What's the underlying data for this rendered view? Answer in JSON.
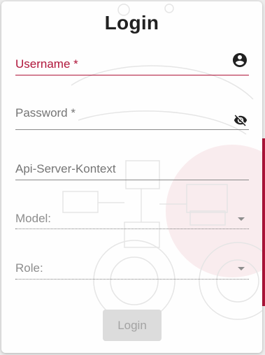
{
  "dialog": {
    "title": "Login"
  },
  "form": {
    "username": {
      "label": "Username",
      "required_mark": "*"
    },
    "password": {
      "label": "Password",
      "required_mark": "*"
    },
    "api_context": {
      "label": "Api-Server-Kontext"
    },
    "model": {
      "label": "Model:"
    },
    "role": {
      "label": "Role:"
    }
  },
  "actions": {
    "login_label": "Login"
  },
  "icons": {
    "username": "account-circle-icon",
    "password": "visibility-off-icon",
    "model_dropdown": "arrow-drop-down-icon",
    "role_dropdown": "arrow-drop-down-icon"
  },
  "colors": {
    "accent": "#b0153a",
    "text": "#212121",
    "muted": "#757575",
    "button_disabled_bg": "#dcdcdc",
    "button_disabled_text": "#a3a3a3"
  }
}
